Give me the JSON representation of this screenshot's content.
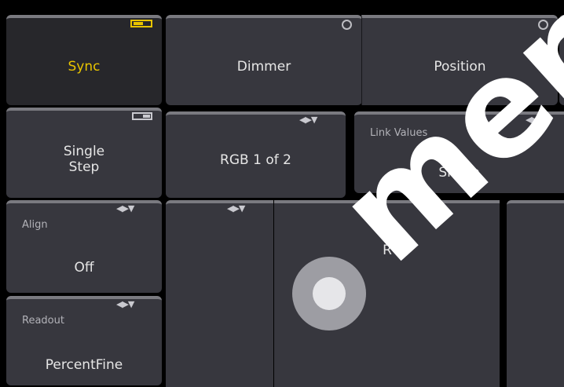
{
  "buttons": {
    "sync": {
      "label": "Sync"
    },
    "single_step": {
      "line1": "Single",
      "line2": "Step"
    },
    "align": {
      "title": "Align",
      "value": "Off"
    },
    "readout": {
      "title": "Readout",
      "value": "PercentFine"
    },
    "dimmer": {
      "label": "Dimmer"
    },
    "position": {
      "label": "Position"
    },
    "rgb": {
      "label": "RGB 1 of 2"
    },
    "link_values": {
      "title": "Link Values",
      "value": "Single"
    },
    "encoder_r": {
      "label": "R"
    }
  },
  "watermark": {
    "text": "men"
  },
  "icons": {
    "toggle_on": "toggle-on-icon",
    "toggle_off": "toggle-off-icon",
    "circle": "circle-indicator-icon",
    "arrows": "left-right-down-arrows-icon"
  },
  "colors": {
    "accent": "#e8c400",
    "tile": "#37373e",
    "tile_active": "#27272b",
    "background": "#000000"
  }
}
